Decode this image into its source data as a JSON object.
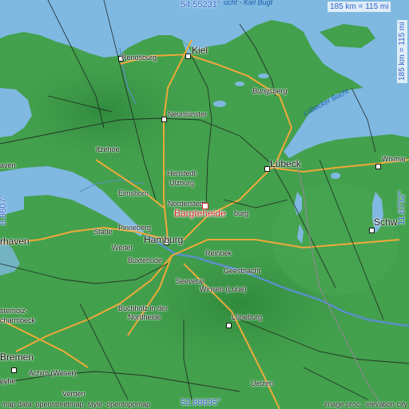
{
  "coords": {
    "top": "54.55231°",
    "bottom": "52.88835°",
    "left": "8.8607°",
    "right": "11.6732°"
  },
  "scale": {
    "horizontal": "185 km = 115 mi",
    "vertical": "185 km = 115 mi"
  },
  "marker": {
    "label": "Bargteheide"
  },
  "water": {
    "kiel_bight": "ucht - Kiel Bugt",
    "luebeck_bay": "Lübecker Bucht"
  },
  "cities": {
    "rendsburg": "Rendsburg",
    "kiel": "Kiel",
    "bungsberg": "Bungsberg",
    "neumuenster": "Neumünster",
    "itzehoe": "Itzehoe",
    "luebeck": "Lübeck",
    "wismar": "Wismar",
    "henstedt": "Henstedt-",
    "ulzburg": "Ulzburg",
    "elmshorn": "Elmshorn",
    "norderstedt": "Norderstedt",
    "burg": "burg",
    "schwerin": "Schw",
    "pinneberg": "Pinneberg",
    "stade": "Stade",
    "hamburg": "Hamburg",
    "bremerhaven": "rhaven",
    "wedel": "Wedel",
    "reinbek": "Reinbek",
    "buxtehude": "Buxtehude",
    "geesthacht": "Geesthacht",
    "seevetal": "Seevetal",
    "winsen": "Winsen (Luhe)",
    "buchholz1": "Buchholz in der",
    "buchholz2": "Nordheide",
    "osterholz1": "sterholz-",
    "osterholz2": "charmbeck",
    "lueneburg": "Lüneburg",
    "bremen": "Bremen",
    "achim": "Achim (Weser)",
    "verden": "Verden",
    "uelzen": "Uelzen",
    "weyhe": "eyhe",
    "haven": "aven"
  },
  "credits": {
    "left": "map data: openstreetmap, style: opentopomap",
    "right": "image proc.: elevation.city"
  },
  "colors": {
    "sea": "#7fb8e0",
    "land": "#3f9a4a",
    "highway": "#f0a93a",
    "marker": "#d42828"
  }
}
